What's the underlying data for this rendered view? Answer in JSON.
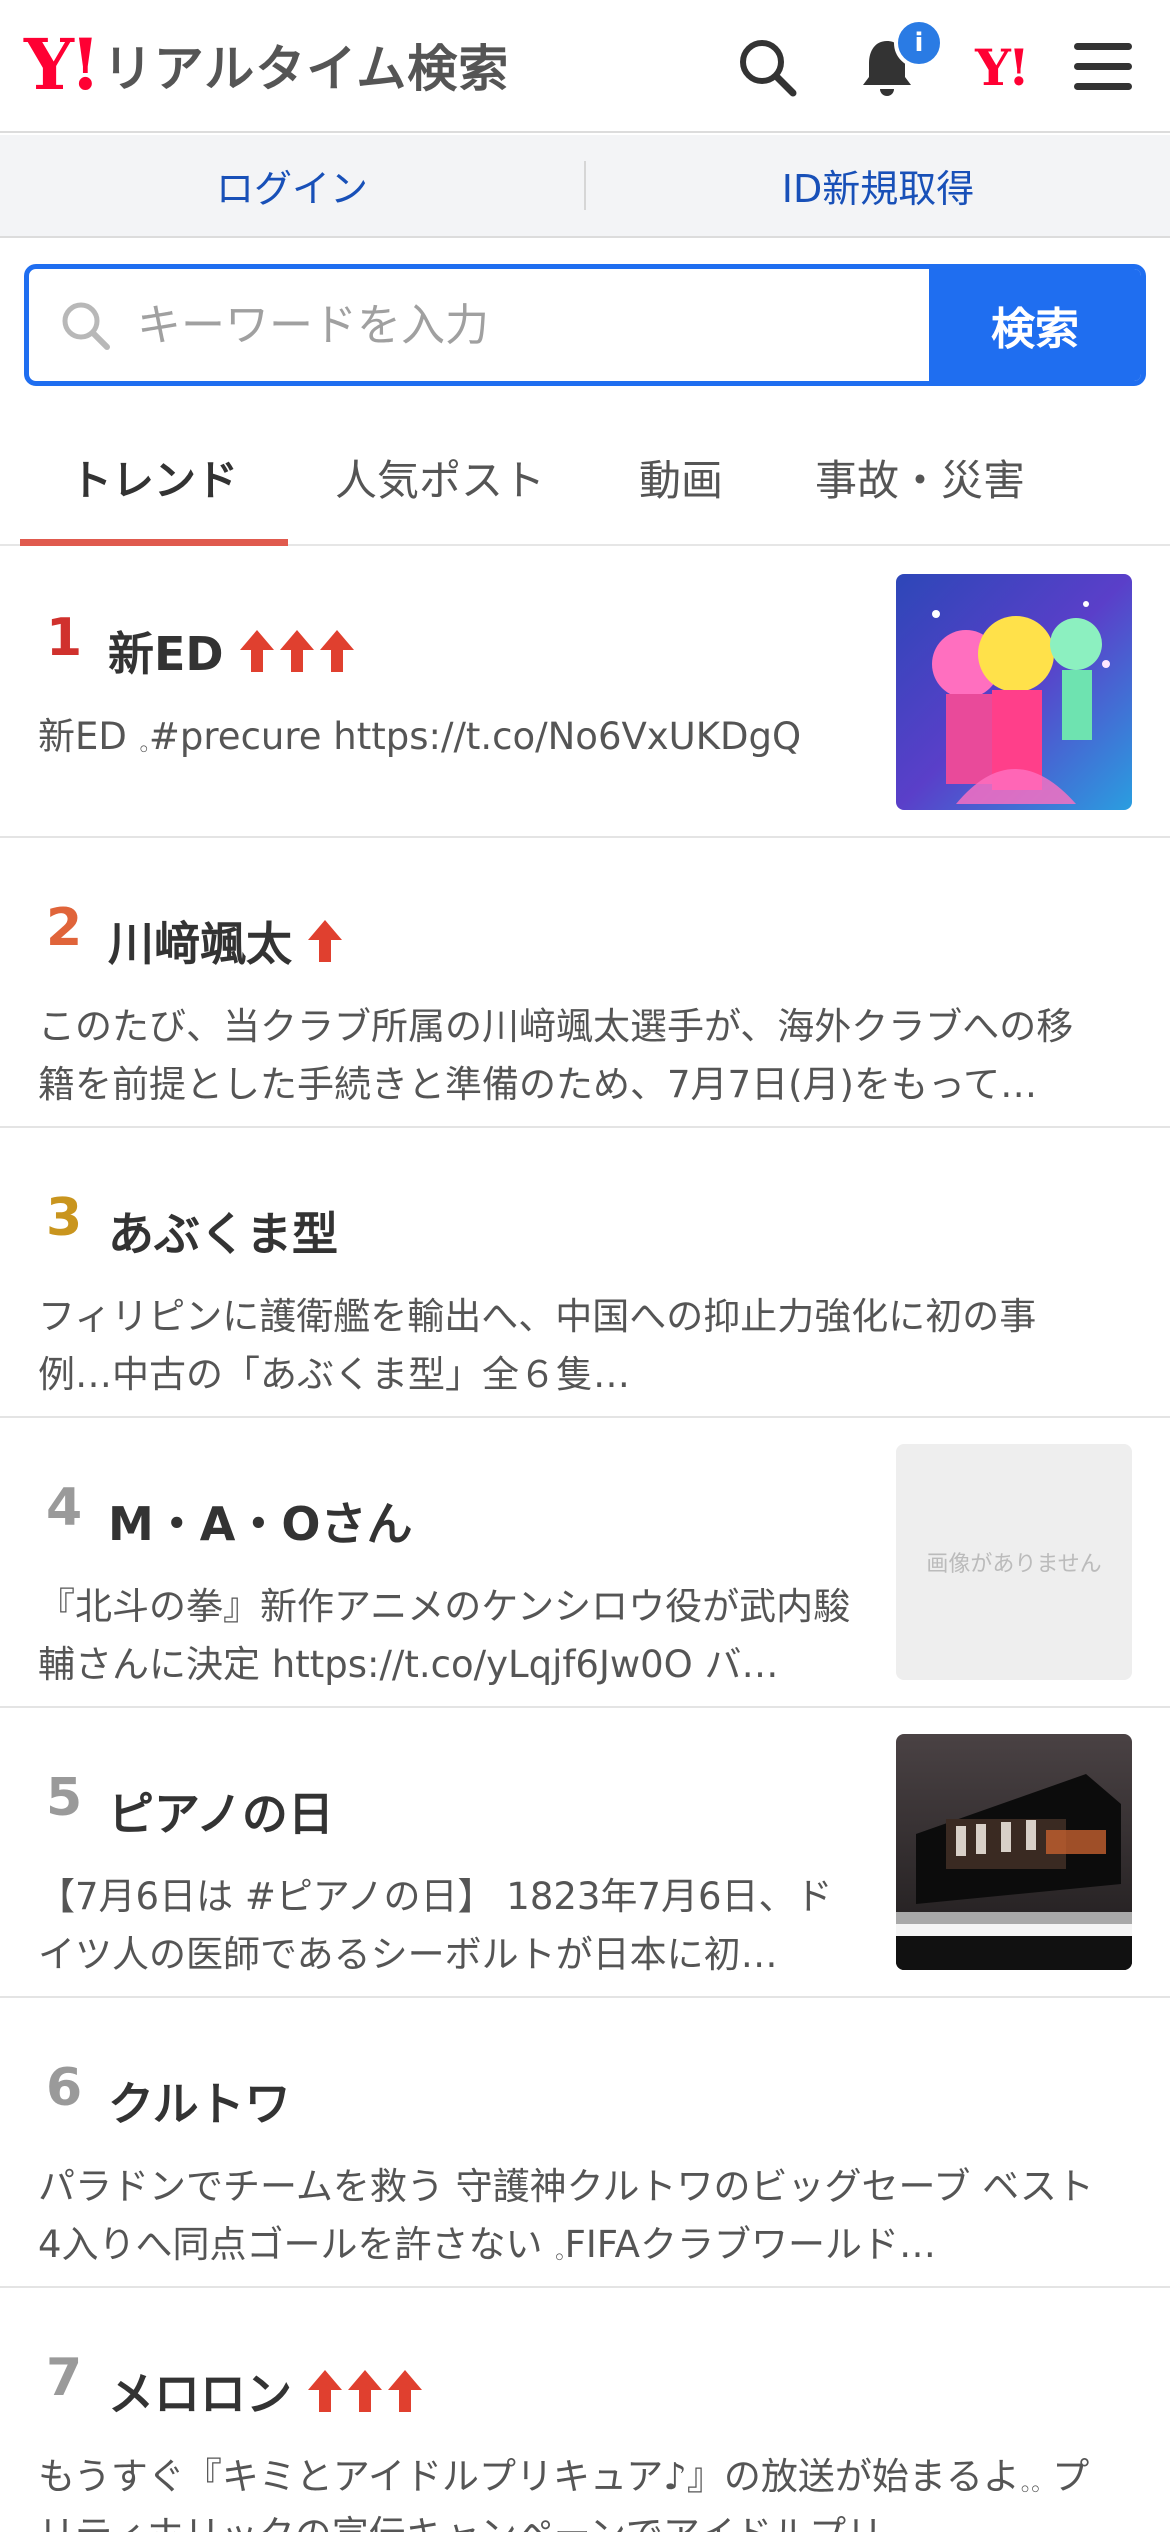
{
  "header": {
    "logo_mark": "Y!",
    "logo_text": "リアルタイム検索",
    "notification_badge": "i",
    "yahoo_mark": "Y!",
    "icons": [
      "search-icon",
      "bell-icon",
      "yahoo-japan-icon",
      "menu-icon"
    ]
  },
  "auth": {
    "login": "ログイン",
    "register": "ID新規取得"
  },
  "search": {
    "placeholder": "キーワードを入力",
    "button": "検索"
  },
  "tabs": [
    {
      "label": "トレンド",
      "active": true
    },
    {
      "label": "人気ポスト",
      "active": false
    },
    {
      "label": "動画",
      "active": false
    },
    {
      "label": "事故・災害",
      "active": false
    }
  ],
  "trends": [
    {
      "rank": "1",
      "rank_color": "#d0312d",
      "title": "新ED",
      "arrows": 3,
      "desc": "新ED 𓈒#precure https://t.co/No6VxUKDgQ",
      "thumb": "anime"
    },
    {
      "rank": "2",
      "rank_color": "#e0643a",
      "title": "川﨑颯太",
      "arrows": 1,
      "desc": "このたび、当クラブ所属の川﨑颯太選手が、海外クラブへの移籍を前提とした手続きと準備のため、7月7日(月)をもって…",
      "thumb": "none"
    },
    {
      "rank": "3",
      "rank_color": "#c9951e",
      "title": "あぶくま型",
      "arrows": 0,
      "desc": "フィリピンに護衛艦を輸出へ、中国への抑止力強化に初の事例…中古の「あぶくま型」全６隻…",
      "thumb": "none"
    },
    {
      "rank": "4",
      "rank_color": "#9a9a9a",
      "title": "M・A・Oさん",
      "arrows": 0,
      "desc": "『北斗の拳』新作アニメのケンシロウ役が武内駿輔さんに決定 https://t.co/yLqjf6Jw0O バ…",
      "thumb": "noimage",
      "noimage_text": "画像がありません"
    },
    {
      "rank": "5",
      "rank_color": "#9a9a9a",
      "title": "ピアノの日",
      "arrows": 0,
      "desc": "【7月6日は #ピアノの日】 1823年7月6日、ドイツ人の医師であるシーボルトが日本に初…",
      "thumb": "piano"
    },
    {
      "rank": "6",
      "rank_color": "#9a9a9a",
      "title": "クルトワ",
      "arrows": 0,
      "desc": "パラドンでチームを救う 守護神クルトワのビッグセーブ ベスト4入りへ同点ゴールを許さない 𓈒FIFAクラブワールド…",
      "thumb": "none"
    },
    {
      "rank": "7",
      "rank_color": "#9a9a9a",
      "title": "メロロン",
      "arrows": 3,
      "desc": "もうすぐ『キミとアイドルプリキュア♪』の放送が始まるよ𓈒𓈒 プリティホリックの宣伝キャンペーンでアイドルプリ…",
      "thumb": "none"
    }
  ],
  "colors": {
    "brand_red": "#ff0033",
    "accent_blue": "#1f6ef0",
    "link_blue": "#1850b8",
    "tab_underline": "#e05a4e",
    "arrow_red": "#e0402f"
  }
}
